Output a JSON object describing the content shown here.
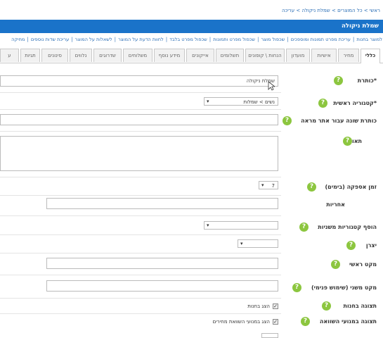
{
  "breadcrumb": "ראשי > כל המוצרים > שמלת ניקולה > עריכה",
  "page_title": "שמלת ניקולה",
  "product_links": [
    "למוצר בחנות",
    "עריכת מפרט תמונות ומוספכים",
    "שכפול מוצר",
    "שכפול מפרט ותמונות",
    "שכפול מפרט בלבד",
    "לחוות הדעת על המוצר",
    "לשאלות על המוצר",
    "עריכת שדות נוספים",
    "מחיקה"
  ],
  "tabs": [
    "כללי",
    "מחיר",
    "אישיות",
    "מועדון",
    "הנחות \\ קופונים",
    "תשלומים",
    "אייקונים",
    "מידע נוסף",
    "משלוחים",
    "שדרוגים",
    "נלווים",
    "סינונים",
    "תגיות",
    "ע"
  ],
  "form": {
    "title_label": "כותרת",
    "title_value": "שמלת ניקולה",
    "main_category_label": "קטגוריה ראשית",
    "main_category_value": "נשים > שמלות",
    "alt_title_label": "כותרת שונה עבור אתר מראה",
    "description_label": "תאור",
    "supply_time_label": "זמן אספקה (בימים)",
    "supply_time_value": "7",
    "warranty_label": "אחריות",
    "secondary_categories_label": "הוסף קטגוריות משניות",
    "manufacturer_label": "יצרן",
    "main_sku_label": "מקט ראשי",
    "secondary_sku_label": "מקט משני (שימוש פנימי)",
    "store_display_label": "תצוגה בחנות",
    "store_display_checkbox": "הצג בחנות",
    "compare_display_label": "תצוגה במנועי השוואה",
    "compare_display_checkbox": "הצג במנועי השוואת מחירים"
  },
  "colors": {
    "header_bg": "#1a73c9",
    "help_icon": "#8cc63f",
    "link": "#2a6db5"
  }
}
